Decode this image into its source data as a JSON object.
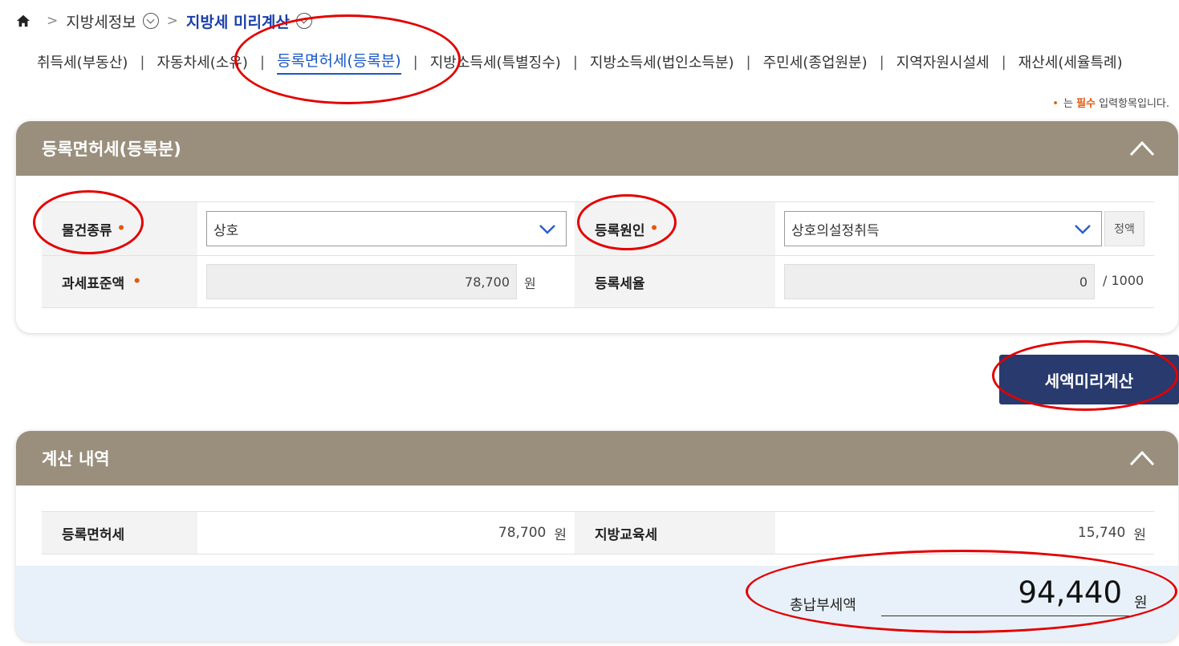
{
  "breadcrumb": {
    "home_icon": "home-icon",
    "level1": "지방세정보",
    "current": "지방세 미리계산"
  },
  "tabs": [
    {
      "label": "취득세(부동산)",
      "active": false
    },
    {
      "label": "자동차세(소유)",
      "active": false
    },
    {
      "label": "등록면허세(등록분)",
      "active": true
    },
    {
      "label": "지방소득세(특별징수)",
      "active": false
    },
    {
      "label": "지방소득세(법인소득분)",
      "active": false
    },
    {
      "label": "주민세(종업원분)",
      "active": false
    },
    {
      "label": "지역자원시설세",
      "active": false
    },
    {
      "label": "재산세(세율특례)",
      "active": false
    }
  ],
  "required_note": {
    "prefix": "는",
    "emphasis": "필수",
    "suffix": "입력항목입니다."
  },
  "form": {
    "title": "등록면허세(등록분)",
    "item_type_label": "물건종류",
    "item_type_value": "상호",
    "reason_label": "등록원인",
    "reason_value": "상호의설정취득",
    "reason_button": "정액",
    "base_label": "과세표준액",
    "base_value": "78,700",
    "base_unit": "원",
    "rate_label": "등록세율",
    "rate_value": "0",
    "rate_unit": "/ 1000"
  },
  "calc_button": "세액미리계산",
  "result": {
    "title": "계산 내역",
    "tax_label": "등록면허세",
    "tax_value": "78,700",
    "tax_unit": "원",
    "edu_label": "지방교육세",
    "edu_value": "15,740",
    "edu_unit": "원",
    "total_label": "총납부세액",
    "total_value": "94,440",
    "total_unit": "원"
  },
  "colors": {
    "panel_header": "#9a8f7d",
    "accent_blue": "#1a56c8",
    "button_navy": "#283a6e",
    "required_orange": "#e05a10",
    "annotation_red": "#e30000",
    "total_bg": "#e8f1f9"
  }
}
